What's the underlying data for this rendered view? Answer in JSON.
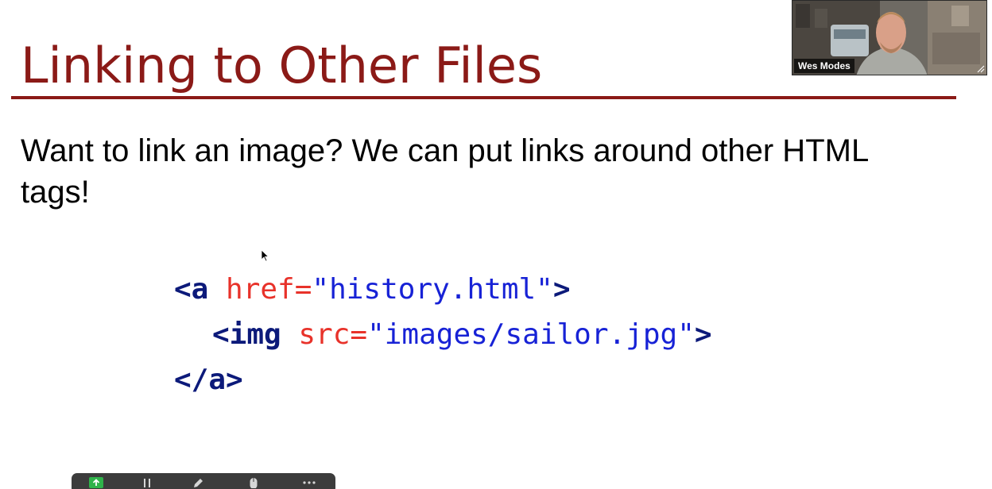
{
  "slide": {
    "title": "Linking to Other Files",
    "body": "Want to link an image? We can put links around other HTML tags!",
    "code_lines": [
      [
        {
          "text": "<a ",
          "kind": "tag"
        },
        {
          "text": "href=",
          "kind": "attr"
        },
        {
          "text": "\"history.html\"",
          "kind": "val"
        },
        {
          "text": ">",
          "kind": "tag"
        }
      ],
      [
        {
          "text": "<img ",
          "kind": "tag"
        },
        {
          "text": "src=",
          "kind": "attr"
        },
        {
          "text": "\"images/sailor.jpg\"",
          "kind": "val"
        },
        {
          "text": ">",
          "kind": "tag"
        }
      ],
      [
        {
          "text": "</a>",
          "kind": "tag"
        }
      ]
    ]
  },
  "video": {
    "participant_name": "Wes Modes"
  },
  "toolbar": {
    "items": [
      "share-icon",
      "pause-icon",
      "pencil-icon",
      "mouse-icon",
      "more-icon"
    ]
  },
  "colors": {
    "title": "#8b1a17",
    "rule": "#8b1a17",
    "code_tag": "#0c1a7a",
    "code_attr": "#e8322a",
    "code_value": "#1722d6",
    "toolbar_green": "#2fb34a"
  }
}
